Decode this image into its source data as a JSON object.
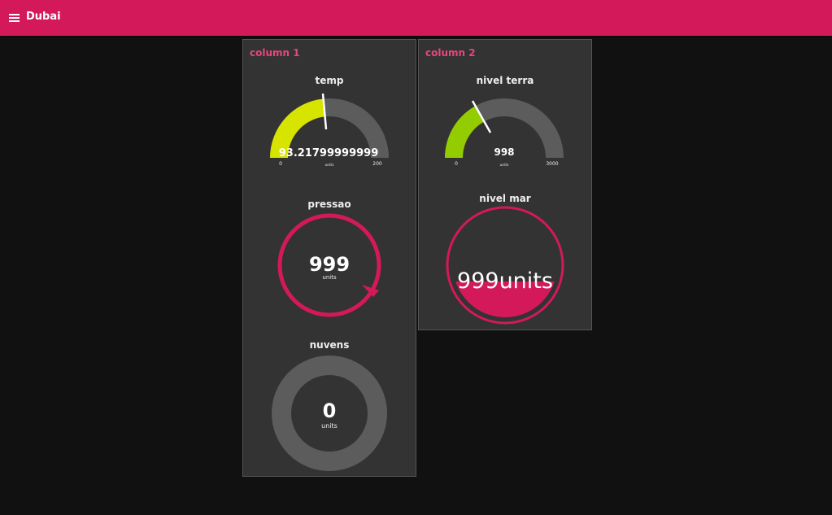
{
  "toolbar": {
    "title": "Dubai",
    "menu_icon": "hamburger-menu-icon",
    "color": "#d4195b"
  },
  "groups": [
    {
      "title": "column 1"
    },
    {
      "title": "column 2"
    }
  ],
  "widgets": {
    "temp": {
      "label": "temp",
      "value": 93.21799999999,
      "value_text": "93.21799999999",
      "units": "units",
      "min": "0",
      "max": "200",
      "fill_color": "#d6e400"
    },
    "pressao": {
      "label": "pressao",
      "value_text": "999",
      "units": "units",
      "color": "#d4195b"
    },
    "nuvens": {
      "label": "nuvens",
      "value_text": "0",
      "units": "units"
    },
    "nivel_terra": {
      "label": "nivel terra",
      "value": 998,
      "value_text": "998",
      "units": "units",
      "min": "0",
      "max": "3000",
      "fill_color": "#93cc00"
    },
    "nivel_mar": {
      "label": "nivel mar",
      "value_text": "999units",
      "fill_level": 0.3,
      "color": "#d4195b"
    }
  }
}
